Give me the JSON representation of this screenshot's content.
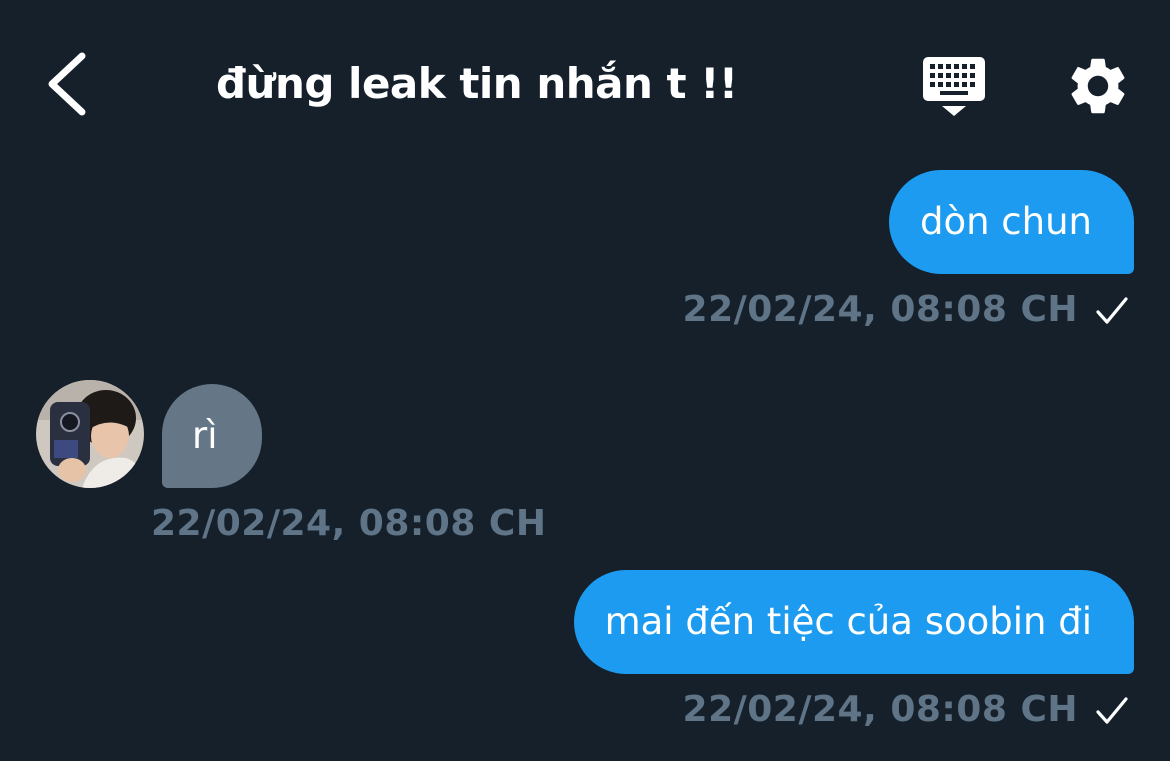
{
  "header": {
    "title": "đừng leak tin nhắn t !!",
    "icons": {
      "back": "chevron-left-icon",
      "keyboard": "keyboard-icon",
      "settings": "gear-icon"
    }
  },
  "messages": [
    {
      "direction": "outgoing",
      "text": "dòn chun",
      "timestamp": "22/02/24, 08:08 CH",
      "status": "check-icon"
    },
    {
      "direction": "incoming",
      "text": "rì",
      "timestamp": "22/02/24, 08:08 CH"
    },
    {
      "direction": "outgoing",
      "text": "mai đến tiệc của soobin đi",
      "timestamp": "22/02/24, 08:08 CH",
      "status": "check-icon"
    }
  ],
  "colors": {
    "background": "#15202b",
    "outgoing_bubble": "#1d9bf0",
    "incoming_bubble": "#657786",
    "timestamp": "#5f7587",
    "text": "#ffffff"
  }
}
